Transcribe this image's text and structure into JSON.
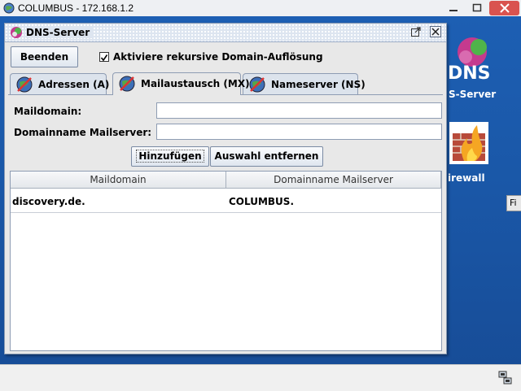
{
  "os_window": {
    "title": "COLUMBUS - 172.168.1.2"
  },
  "desktop": {
    "icons": [
      {
        "label": "DNS-Server",
        "partial_visible": "S-Server",
        "icon_text": "DNS"
      },
      {
        "label": "Firewall",
        "partial_visible": "irewall"
      }
    ],
    "edge_tab": "Fi"
  },
  "dialog": {
    "title": "DNS-Server",
    "toolbar": {
      "quit_label": "Beenden",
      "recursive_checkbox_label": "Aktiviere rekursive Domain-Auflösung",
      "recursive_checked": true
    },
    "tabs": [
      {
        "label": "Adressen (A)",
        "active": false
      },
      {
        "label": "Mailaustausch (MX)",
        "active": true
      },
      {
        "label": "Nameserver (NS)",
        "active": false
      }
    ],
    "form": {
      "maildomain_label": "Maildomain:",
      "maildomain_value": "",
      "mailserver_label": "Domainname Mailserver:",
      "mailserver_value": "",
      "add_label": "Hinzufügen",
      "remove_label": "Auswahl entfernen"
    },
    "table": {
      "columns": [
        "Maildomain",
        "Domainname Mailserver"
      ],
      "rows": [
        [
          "discovery.de.",
          "COLUMBUS."
        ]
      ]
    }
  },
  "colors": {
    "desktop_blue": "#1a57a7",
    "close_red": "#d9534f",
    "panel_gray": "#e8e8e8"
  }
}
